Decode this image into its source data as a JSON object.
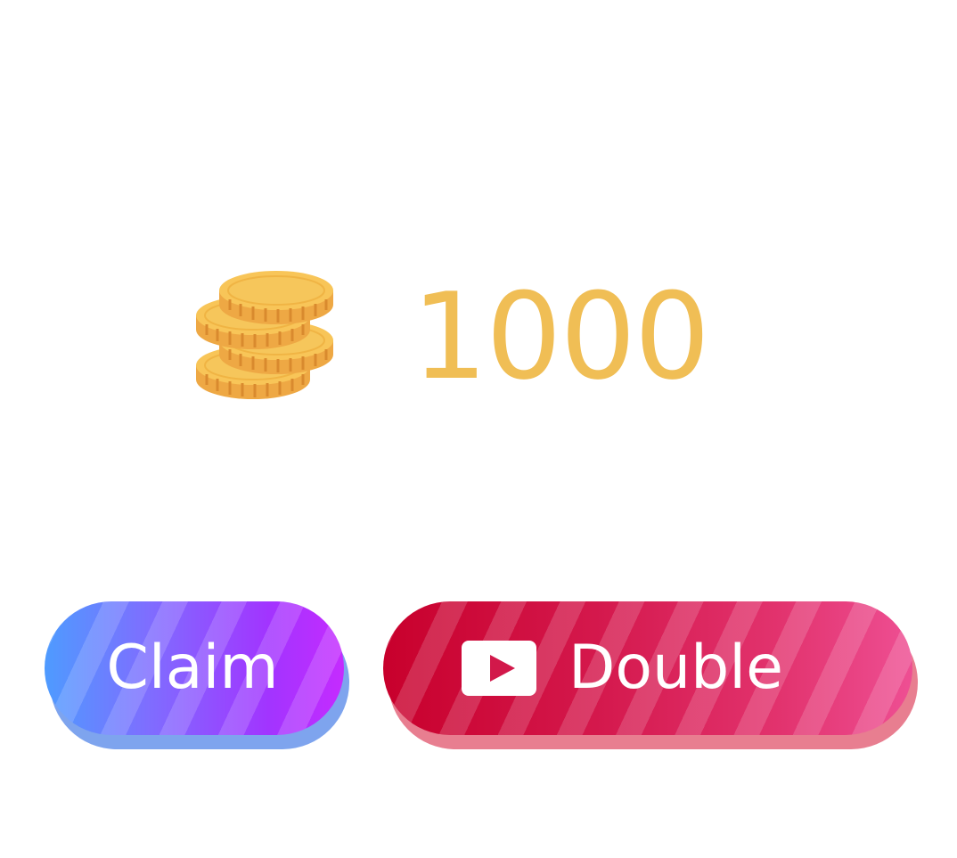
{
  "reward": {
    "icon": "coin-stack-icon",
    "amount": "1000",
    "amount_color": "#f0be55"
  },
  "buttons": {
    "claim_label": "Claim",
    "double_label": "Double",
    "double_icon": "video-play-icon"
  },
  "colors": {
    "claim_gradient": [
      "#4e9bff",
      "#7f6dff",
      "#a234ff",
      "#c52bff"
    ],
    "claim_shadow": "#7ea4ee",
    "double_gradient": [
      "#c8002c",
      "#d4184c",
      "#e2336e",
      "#ee4f93"
    ],
    "double_shadow": "#e87e90"
  }
}
